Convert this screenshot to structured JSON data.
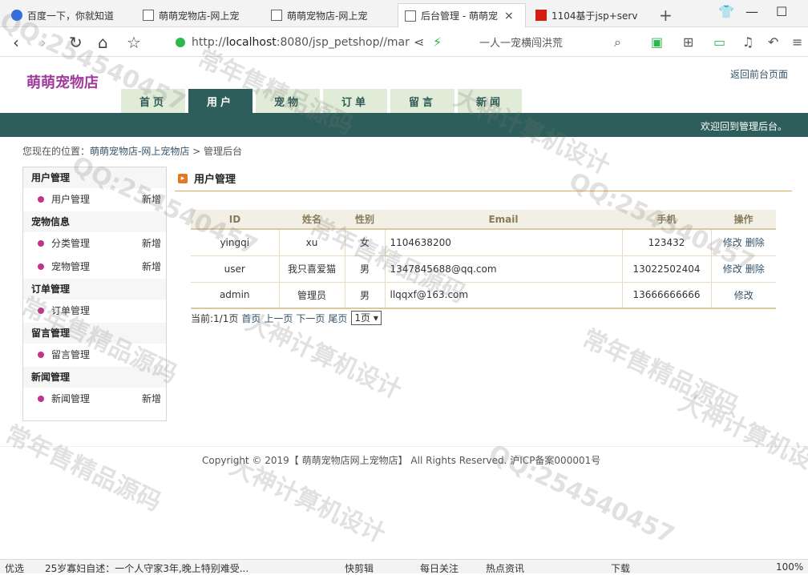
{
  "browser": {
    "tabs": [
      {
        "title": "百度一下，你就知道",
        "fav": "baidu"
      },
      {
        "title": "萌萌宠物店-网上宠",
        "fav": "page"
      },
      {
        "title": "萌萌宠物店-网上宠",
        "fav": "page"
      },
      {
        "title": "后台管理 - 萌萌宠",
        "fav": "page",
        "active": true
      },
      {
        "title": "1104基于jsp+serv",
        "fav": "red"
      }
    ],
    "new_tab": "+",
    "url_prefix": "http://",
    "url_host": "localhost",
    "url_rest": ":8080/jsp_petshop//mar",
    "search_text": "一人一宠横闯洪荒"
  },
  "header": {
    "logo": "萌萌宠物店",
    "back_link": "返回前台页面",
    "nav": [
      {
        "label": "首页"
      },
      {
        "label": "用户",
        "active": true
      },
      {
        "label": "宠物"
      },
      {
        "label": "订单"
      },
      {
        "label": "留言"
      },
      {
        "label": "新闻"
      }
    ],
    "welcome": "欢迎回到管理后台。"
  },
  "breadcrumb": {
    "prefix": "您现在的位置：",
    "link": "萌萌宠物店-网上宠物店",
    "suffix": " > 管理后台"
  },
  "sidebar": [
    {
      "heading": "用户管理",
      "items": [
        {
          "label": "用户管理",
          "add": "新增"
        }
      ]
    },
    {
      "heading": "宠物信息",
      "items": [
        {
          "label": "分类管理",
          "add": "新增"
        },
        {
          "label": "宠物管理",
          "add": "新增"
        }
      ]
    },
    {
      "heading": "订单管理",
      "items": [
        {
          "label": "订单管理",
          "add": ""
        }
      ]
    },
    {
      "heading": "留言管理",
      "items": [
        {
          "label": "留言管理",
          "add": ""
        }
      ]
    },
    {
      "heading": "新闻管理",
      "items": [
        {
          "label": "新闻管理",
          "add": "新增"
        }
      ]
    }
  ],
  "content": {
    "title": "用户管理",
    "columns": [
      "ID",
      "姓名",
      "性别",
      "Email",
      "手机",
      "操作"
    ],
    "rows": [
      {
        "id": "yingqi",
        "name": "xu",
        "gender": "女",
        "email": "1104638200",
        "phone": "123432",
        "ops": [
          "修改",
          "删除"
        ]
      },
      {
        "id": "user",
        "name": "我只喜爱猫",
        "gender": "男",
        "email": "1347845688@qq.com",
        "phone": "13022502404",
        "ops": [
          "修改",
          "删除"
        ]
      },
      {
        "id": "admin",
        "name": "管理员",
        "gender": "男",
        "email": "llqqxf@163.com",
        "phone": "13666666666",
        "ops": [
          "修改"
        ]
      }
    ],
    "pager": {
      "current": "当前:1/1页",
      "first": "首页",
      "prev": "上一页",
      "next": "下一页",
      "last": "尾页",
      "select": "1页 ▾"
    }
  },
  "footer": "Copyright © 2019【 萌萌宠物店网上宠物店】 All Rights Reserved. 沪ICP备案000001号",
  "statusbar": {
    "left": "优选",
    "news": "25岁寡妇自述：一个人守家3年,晚上特别难受...",
    "kuaijian": "快剪辑",
    "meiri": "每日关注",
    "redian": "热点资讯",
    "download": "下载",
    "zoom": "100%"
  },
  "watermarks": [
    "QQ:254540457",
    "常年售精品源码",
    "大神计算机设计"
  ]
}
